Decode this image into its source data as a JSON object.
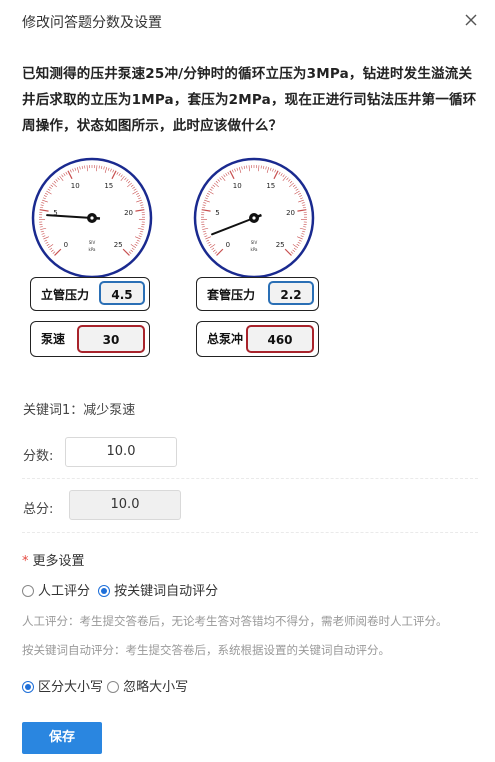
{
  "dialog": {
    "title": "修改问答题分数及设置"
  },
  "question": {
    "text": "已知测得的压井泵速25冲/分钟时的循环立压为3MPa，钻进时发生溢流关井后求取的立压为1MPa，套压为2MPa，现在正进行司钻法压井第一循环周操作，状态如图所示，此时应该做什么？"
  },
  "figure": {
    "gauge_ticks": [
      "0",
      "5",
      "10",
      "15",
      "20",
      "25"
    ],
    "gauge_unit": "kPa",
    "gauge_unit_top": "SIV",
    "gauge_left_pointer_reading": 4.5,
    "gauge_right_pointer_reading": 2.2,
    "standpipe": {
      "label": "立管压力",
      "value": "4.5"
    },
    "casing": {
      "label": "套管压力",
      "value": "2.2"
    },
    "pump_rate": {
      "label": "泵速",
      "value": "30"
    },
    "total_strokes": {
      "label": "总泵冲",
      "value": "460"
    },
    "colors": {
      "blue_box": "#2a6fb5",
      "red_box": "#a8232b",
      "gauge_ring": "#1a2a8f"
    }
  },
  "keywords": {
    "label": "关键词1：",
    "value": "减少泵速"
  },
  "score": {
    "label": "分数:",
    "value": "10.0"
  },
  "total": {
    "label": "总分:",
    "value": "10.0"
  },
  "more_settings": {
    "label": "更多设置",
    "mode_options": [
      {
        "label": "人工评分",
        "selected": false
      },
      {
        "label": "按关键词自动评分",
        "selected": true
      }
    ],
    "hint_manual": "人工评分：考生提交答卷后，无论考生答对答错均不得分，需老师阅卷时人工评分。",
    "hint_auto": "按关键词自动评分：考生提交答卷后，系统根据设置的关键词自动评分。",
    "case_options": [
      {
        "label": "区分大小写",
        "selected": true
      },
      {
        "label": "忽略大小写",
        "selected": false
      }
    ]
  },
  "save_label": "保存",
  "accent_color": "#2a86e0"
}
